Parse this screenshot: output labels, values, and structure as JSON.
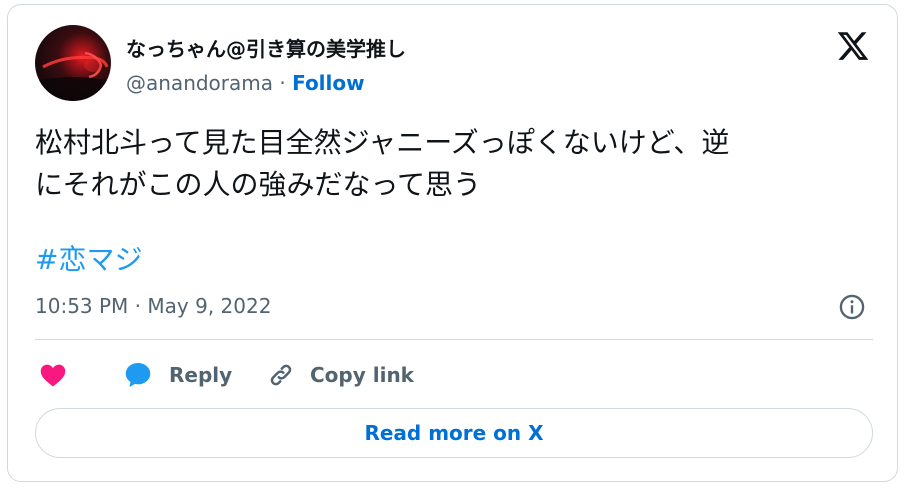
{
  "author": {
    "display_name": "なっちゃん@引き算の美学推し",
    "handle": "@anandorama",
    "separator": " · ",
    "follow_label": "Follow"
  },
  "tweet": {
    "text_lines": [
      "松村北斗って見た目全然ジャニーズっぽくないけど、逆",
      "にそれがこの人の強みだなって思う"
    ],
    "hashtag": "#恋マジ",
    "timestamp": "10:53 PM · May 9, 2022"
  },
  "actions": {
    "like_icon": "heart-icon",
    "reply_label": "Reply",
    "reply_icon": "speech-bubble-icon",
    "copy_link_label": "Copy link",
    "copy_link_icon": "link-icon"
  },
  "read_more_label": "Read more on X",
  "colors": {
    "accent_blue": "#006fd6",
    "hashtag_blue": "#1d9bf0",
    "like_pink": "#f91880",
    "muted_gray": "#536471",
    "border": "#cfd9de"
  }
}
